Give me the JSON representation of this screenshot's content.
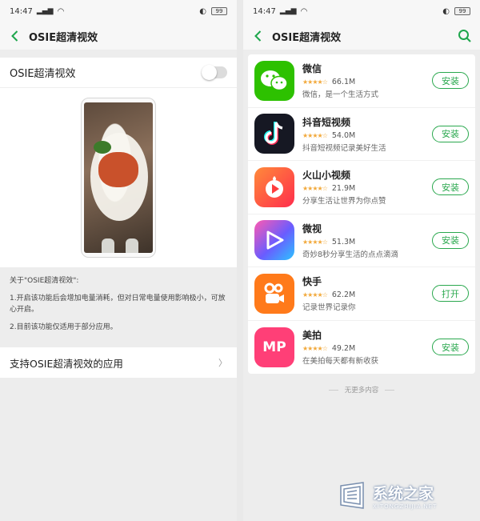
{
  "left_screen": {
    "status": {
      "time": "14:47",
      "signal": "5G",
      "battery": "99"
    },
    "header": {
      "title": "OSIE超清视效"
    },
    "toggle": {
      "label": "OSIE超清视效",
      "enabled": false
    },
    "info": {
      "heading": "关于\"OSIE超清视效\":",
      "line1": "1.开启该功能后会增加电量消耗，但对日常电量使用影响极小，可放心开启。",
      "line2": "2.目前该功能仅适用于部分应用。"
    },
    "support": {
      "label": "支持OSIE超清视效的应用",
      "chevron": "〉"
    }
  },
  "right_screen": {
    "status": {
      "time": "14:47",
      "signal": "5G",
      "battery": "99"
    },
    "header": {
      "title": "OSIE超清视效"
    },
    "apps": [
      {
        "name": "微信",
        "stars": "★★★★☆",
        "rating_value": 3.5,
        "downloads": "66.1M",
        "desc": "微信，是一个生活方式",
        "button": "安装",
        "icon": "wechat-icon",
        "color": "#2dc100"
      },
      {
        "name": "抖音短视频",
        "stars": "★★★★☆",
        "rating_value": 3.5,
        "downloads": "54.0M",
        "desc": "抖音短视频记录美好生活",
        "button": "安装",
        "icon": "douyin-icon",
        "color": "#161823"
      },
      {
        "name": "火山小视频",
        "stars": "★★★★☆",
        "rating_value": 4,
        "downloads": "21.9M",
        "desc": "分享生活让世界为你点赞",
        "button": "安装",
        "icon": "huoshan-icon",
        "color": "#ff4d2e"
      },
      {
        "name": "微视",
        "stars": "★★★★☆",
        "rating_value": 4,
        "downloads": "51.3M",
        "desc": "奇妙8秒分享生活的点点滴滴",
        "button": "安装",
        "icon": "weishi-icon",
        "color": "#6a5cff"
      },
      {
        "name": "快手",
        "stars": "★★★★☆",
        "rating_value": 4.5,
        "downloads": "62.2M",
        "desc": "记录世界记录你",
        "button": "打开",
        "icon": "kuaishou-icon",
        "color": "#ff7a1a"
      },
      {
        "name": "美拍",
        "stars": "★★★★☆",
        "rating_value": 4,
        "downloads": "49.2M",
        "desc": "在美拍每天都有新收获",
        "button": "安装",
        "icon": "meipai-icon",
        "color": "#ff3f77"
      }
    ],
    "footer": "无更多内容"
  },
  "watermark": {
    "text": "系统之家",
    "sub": "XITONGZHIJIA.NET"
  },
  "colors": {
    "accent": "#2aa84e",
    "star": "#f2a93b"
  }
}
